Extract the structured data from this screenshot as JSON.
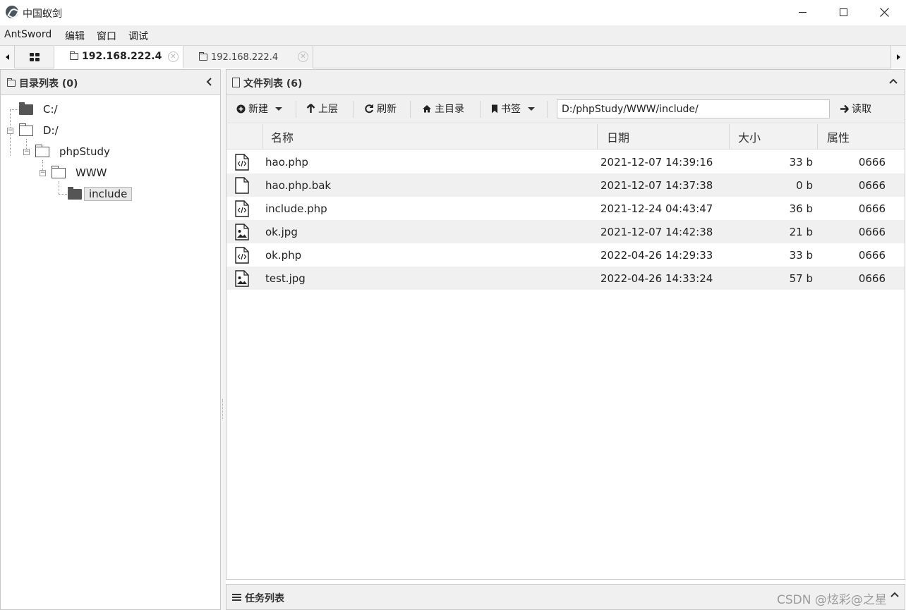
{
  "window": {
    "title": "中国蚁剑"
  },
  "menu": {
    "items": [
      "AntSword",
      "编辑",
      "窗口",
      "调试"
    ]
  },
  "tabs": [
    {
      "label": "192.168.222.4",
      "active": true
    },
    {
      "label": "192.168.222.4",
      "active": false
    }
  ],
  "dir_panel": {
    "title": "目录列表 (0)",
    "tree": [
      {
        "label": "C:/",
        "level": 0,
        "expanded": false
      },
      {
        "label": "D:/",
        "level": 0,
        "expanded": true
      },
      {
        "label": "phpStudy",
        "level": 1,
        "expanded": true
      },
      {
        "label": "WWW",
        "level": 2,
        "expanded": true
      },
      {
        "label": "include",
        "level": 3,
        "selected": true
      }
    ]
  },
  "file_panel": {
    "title": "文件列表 (6)",
    "toolbar": {
      "new_label": "新建",
      "up_label": "上层",
      "refresh_label": "刷新",
      "home_label": "主目录",
      "bookmark_label": "书签",
      "path_value": "D:/phpStudy/WWW/include/",
      "read_label": "读取"
    },
    "columns": [
      "名称",
      "日期",
      "大小",
      "属性"
    ],
    "rows": [
      {
        "icon": "php-file-icon",
        "name": "hao.php",
        "date": "2021-12-07 14:39:16",
        "size": "33 b",
        "attr": "0666"
      },
      {
        "icon": "blank-file-icon",
        "name": "hao.php.bak",
        "date": "2021-12-07 14:37:38",
        "size": "0 b",
        "attr": "0666"
      },
      {
        "icon": "php-file-icon",
        "name": "include.php",
        "date": "2021-12-24 04:43:47",
        "size": "36 b",
        "attr": "0666"
      },
      {
        "icon": "image-file-icon",
        "name": "ok.jpg",
        "date": "2021-12-07 14:42:38",
        "size": "21 b",
        "attr": "0666"
      },
      {
        "icon": "php-file-icon",
        "name": "ok.php",
        "date": "2022-04-26 14:29:33",
        "size": "33 b",
        "attr": "0666"
      },
      {
        "icon": "image-file-icon",
        "name": "test.jpg",
        "date": "2022-04-26 14:33:24",
        "size": "57 b",
        "attr": "0666"
      }
    ]
  },
  "task_panel": {
    "title": "任务列表"
  },
  "watermark": "CSDN @炫彩@之星",
  "colors": {
    "row_alt": "#f0f0f0",
    "toolbar_bg": "#f0f0f0",
    "selected_node_bg": "#e8e8e8"
  }
}
